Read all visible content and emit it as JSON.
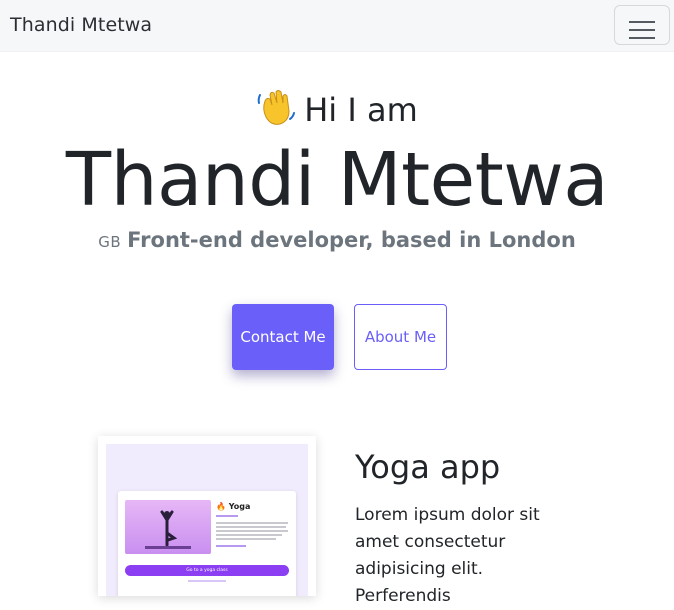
{
  "navbar": {
    "brand": "Thandi Mtetwa",
    "toggle_icon": "hamburger-menu-icon"
  },
  "hero": {
    "greeting_emoji": "👋",
    "greeting": "Hi I am",
    "name": "Thandi Mtetwa",
    "flag_code": "GB",
    "tagline": "Front-end developer, based in London"
  },
  "buttons": {
    "contact": "Contact Me",
    "about": "About Me"
  },
  "colors": {
    "accent": "#6a5ff8",
    "navbar_bg": "#f6f7f9",
    "text": "#212529",
    "muted": "#6c757d"
  },
  "project": {
    "title": "Yoga app",
    "description": "Lorem ipsum dolor sit amet consectetur adipisicing elit. Perferendis",
    "screenshot": {
      "title": "Yoga",
      "button": "Go to a yoga class"
    }
  }
}
